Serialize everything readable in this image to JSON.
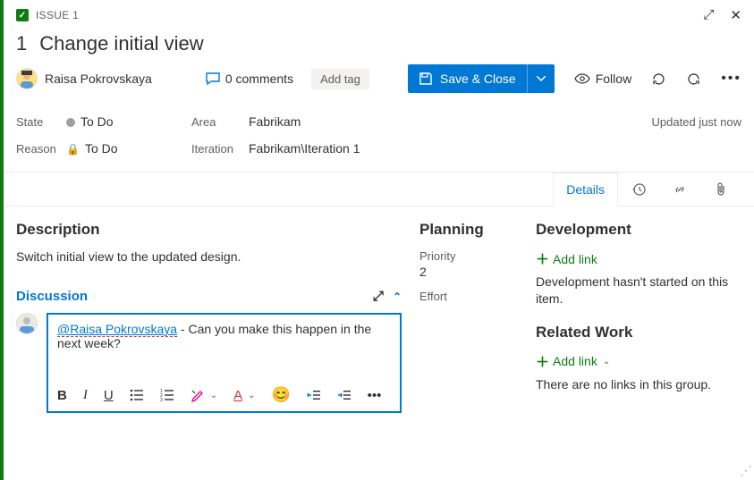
{
  "header": {
    "type_label": "ISSUE 1",
    "id": "1",
    "title": "Change initial view"
  },
  "assignee": {
    "name": "Raisa Pokrovskaya"
  },
  "toolbar": {
    "comments_label": "0 comments",
    "add_tag": "Add tag",
    "save_label": "Save & Close",
    "follow_label": "Follow"
  },
  "meta": {
    "state_label": "State",
    "reason_label": "Reason",
    "area_label": "Area",
    "iteration_label": "Iteration",
    "state_value": "To Do",
    "reason_value": "To Do",
    "area_value": "Fabrikam",
    "iteration_value": "Fabrikam\\Iteration 1",
    "updated": "Updated just now"
  },
  "tabs": {
    "details": "Details"
  },
  "description": {
    "heading": "Description",
    "body": "Switch initial view to the updated design."
  },
  "discussion": {
    "heading": "Discussion",
    "mention": "@Raisa Pokrovskaya",
    "comment_rest": " - Can you make this happen in the next week?"
  },
  "planning": {
    "heading": "Planning",
    "priority_label": "Priority",
    "priority_value": "2",
    "effort_label": "Effort"
  },
  "development": {
    "heading": "Development",
    "add_link": "Add link",
    "empty": "Development hasn't started on this item."
  },
  "related": {
    "heading": "Related Work",
    "add_link": "Add link",
    "empty": "There are no links in this group."
  }
}
